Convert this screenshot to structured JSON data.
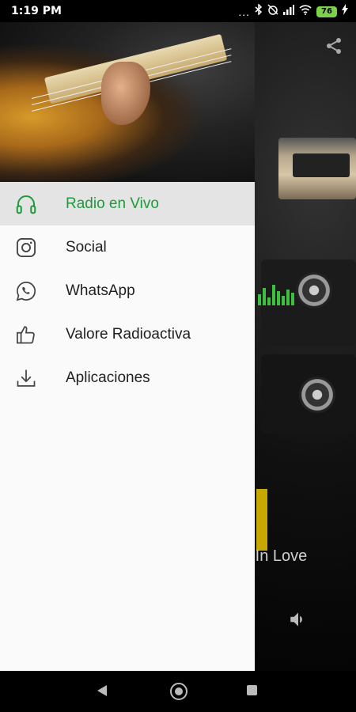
{
  "status_bar": {
    "time": "1:19 PM",
    "overflow_dots": "...",
    "battery_level": "76"
  },
  "drawer": {
    "active_color": "#1f9a3a",
    "menu_items": [
      {
        "label": "Radio en Vivo",
        "icon": "headphones-icon",
        "active": true
      },
      {
        "label": "Social",
        "icon": "instagram-icon",
        "active": false
      },
      {
        "label": "WhatsApp",
        "icon": "whatsapp-icon",
        "active": false
      },
      {
        "label": "Valore Radioactiva",
        "icon": "thumbs-up-icon",
        "active": false
      },
      {
        "label": "Aplicaciones",
        "icon": "download-icon",
        "active": false
      }
    ]
  },
  "player": {
    "song_title_partial": "e In Love",
    "share_icon": "share-icon",
    "volume_icon": "volume-icon"
  },
  "nav_bar": {
    "back_icon": "back-triangle-icon",
    "home_icon": "home-circle-icon",
    "recents_icon": "recents-square-icon"
  }
}
